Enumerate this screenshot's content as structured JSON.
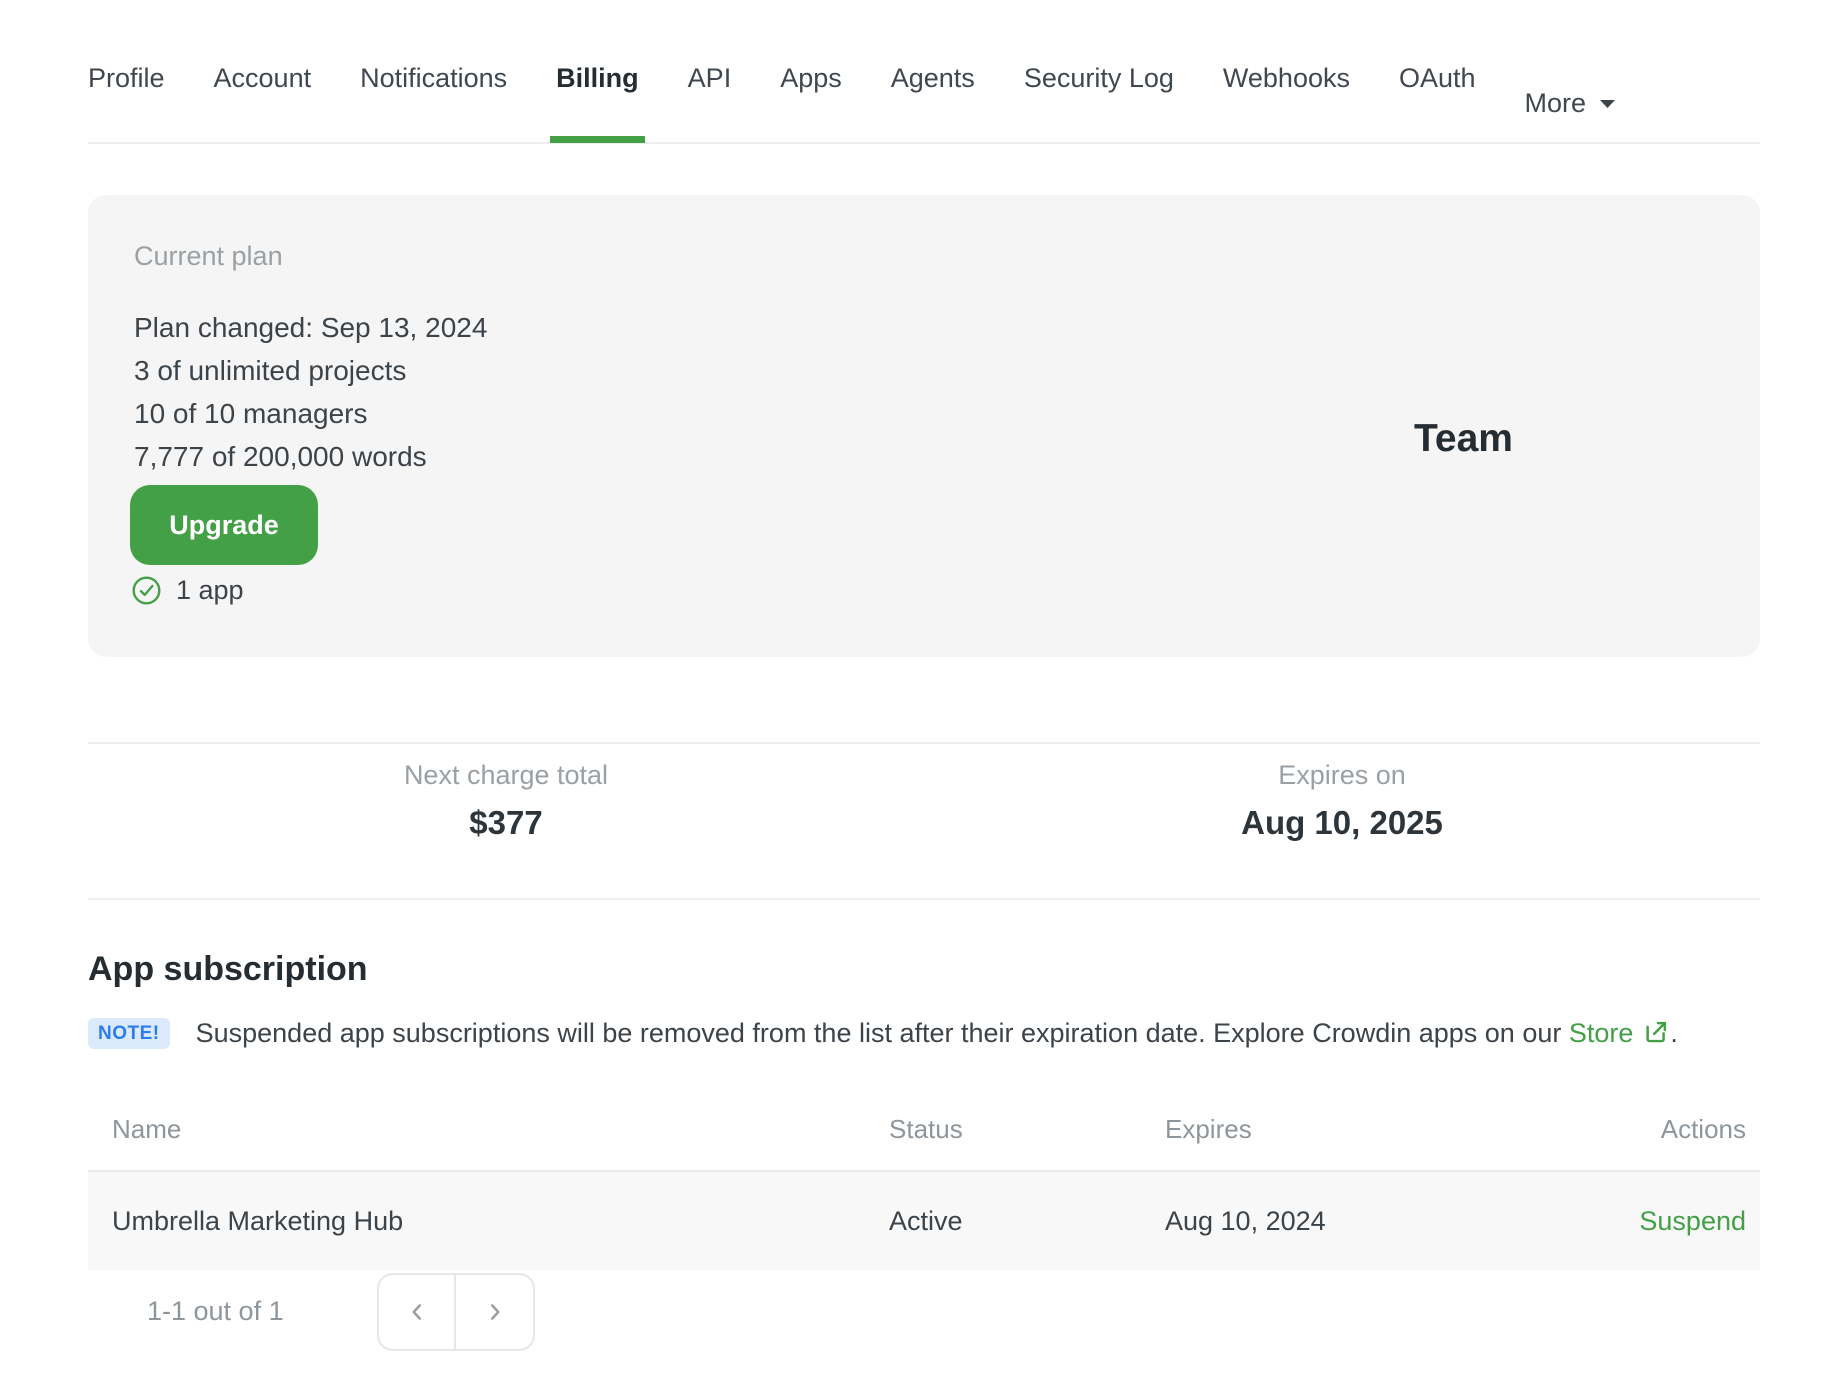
{
  "nav": {
    "tabs": [
      {
        "label": "Profile"
      },
      {
        "label": "Account"
      },
      {
        "label": "Notifications"
      },
      {
        "label": "Billing"
      },
      {
        "label": "API"
      },
      {
        "label": "Apps"
      },
      {
        "label": "Agents"
      },
      {
        "label": "Security Log"
      },
      {
        "label": "Webhooks"
      },
      {
        "label": "OAuth"
      },
      {
        "label": "More"
      }
    ],
    "active_tab": "Billing"
  },
  "plan_card": {
    "label": "Current plan",
    "lines": [
      "Plan changed: Sep 13, 2024",
      "3 of unlimited projects",
      "10 of 10 managers",
      "7,777 of 200,000 words"
    ],
    "upgrade_label": "Upgrade",
    "apps_line": "1 app",
    "plan_name": "Team"
  },
  "billing_summary": {
    "next_charge": {
      "label": "Next charge total",
      "value": "$377"
    },
    "expires": {
      "label": "Expires on",
      "value": "Aug 10, 2025"
    }
  },
  "app_subscription": {
    "heading": "App subscription",
    "note_badge": "NOTE!",
    "note_text_before": "Suspended app subscriptions will be removed from the list after their expiration date. Explore Crowdin apps on our ",
    "note_link": "Store",
    "note_text_after": ".",
    "table": {
      "headers": [
        "Name",
        "Status",
        "Expires",
        "Actions"
      ],
      "rows": [
        {
          "name": "Umbrella Marketing Hub",
          "status": "Active",
          "expires": "Aug 10, 2024",
          "action": "Suspend"
        }
      ]
    },
    "pagination": {
      "label": "1-1 out of 1"
    }
  },
  "colors": {
    "accent_green": "#43a047",
    "note_blue": "#2b7de9",
    "note_badge_bg": "#dbe9fc",
    "card_bg": "#f5f5f5",
    "row_bg": "#f8f8f8",
    "muted_gray": "#9aa0a4"
  }
}
